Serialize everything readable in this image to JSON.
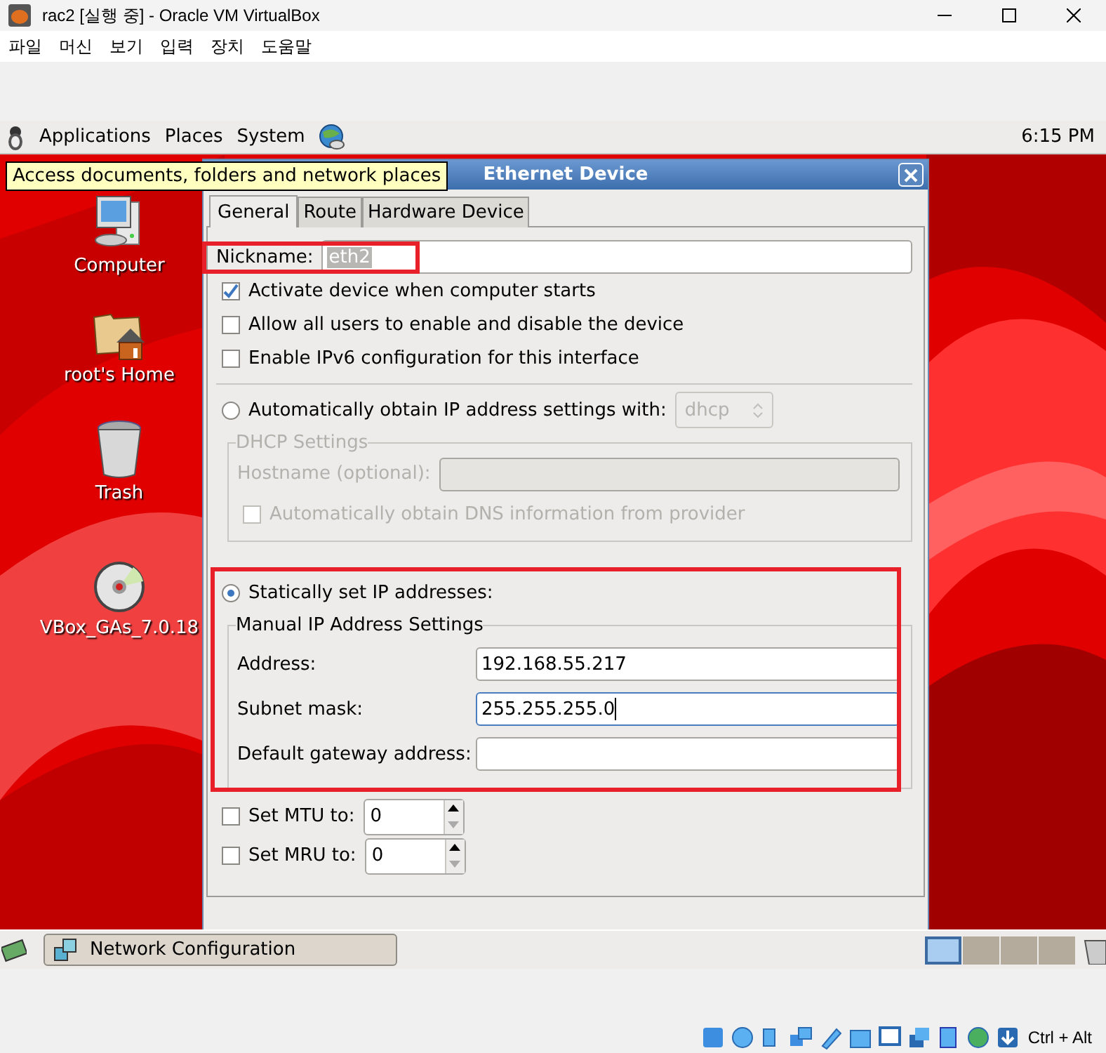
{
  "host_window": {
    "title": "rac2 [실행 중] - Oracle VM VirtualBox",
    "menu": [
      "파일",
      "머신",
      "보기",
      "입력",
      "장치",
      "도움말"
    ]
  },
  "top_panel": {
    "menus": [
      "Applications",
      "Places",
      "System"
    ],
    "clock": "6:15 PM"
  },
  "tooltip": "Access documents, folders and network places",
  "desktop_icons": [
    {
      "label": "Computer",
      "kind": "computer"
    },
    {
      "label": "root's Home",
      "kind": "home"
    },
    {
      "label": "Trash",
      "kind": "trash"
    },
    {
      "label": "VBox_GAs_7.0.18",
      "kind": "disc"
    }
  ],
  "dialog": {
    "title": "Ethernet Device",
    "tabs": [
      {
        "label": "General",
        "selected": true
      },
      {
        "label": "Route",
        "selected": false
      },
      {
        "label": "Hardware Device",
        "selected": false
      }
    ],
    "nickname": {
      "label": "Nickname:",
      "value": "eth2"
    },
    "options": [
      {
        "label": "Activate device when computer starts",
        "checked": true
      },
      {
        "label": "Allow all users to enable and disable the device",
        "checked": false
      },
      {
        "label": "Enable IPv6 configuration for this interface",
        "checked": false
      }
    ],
    "auto": {
      "label": "Automatically obtain IP address settings with:",
      "selected": false,
      "protocol": "dhcp"
    },
    "dhcp": {
      "title": "DHCP Settings",
      "disabled": true,
      "hostname_label": "Hostname (optional):",
      "dns_label": "Automatically obtain DNS information from provider",
      "dns_checked": false
    },
    "static": {
      "label": "Statically set IP addresses:",
      "selected": true
    },
    "manual": {
      "title": "Manual IP Address Settings",
      "fields": [
        {
          "label": "Address:",
          "value": "192.168.55.217",
          "focused": false
        },
        {
          "label": "Subnet mask:",
          "value": "255.255.255.0",
          "focused": true
        },
        {
          "label": "Default gateway address:",
          "focused": false
        }
      ]
    },
    "spins": [
      {
        "label": "Set MTU to:",
        "checked": false,
        "value": "0"
      },
      {
        "label": "Set MRU to:",
        "checked": false,
        "value": "0"
      }
    ]
  },
  "taskbar": {
    "tasks": [
      "Network Configuration"
    ],
    "workspaces": [
      {
        "selected": true
      },
      {
        "selected": false
      },
      {
        "selected": false
      },
      {
        "selected": false
      }
    ]
  },
  "host_status": {
    "shortcut": "Ctrl + Alt"
  }
}
